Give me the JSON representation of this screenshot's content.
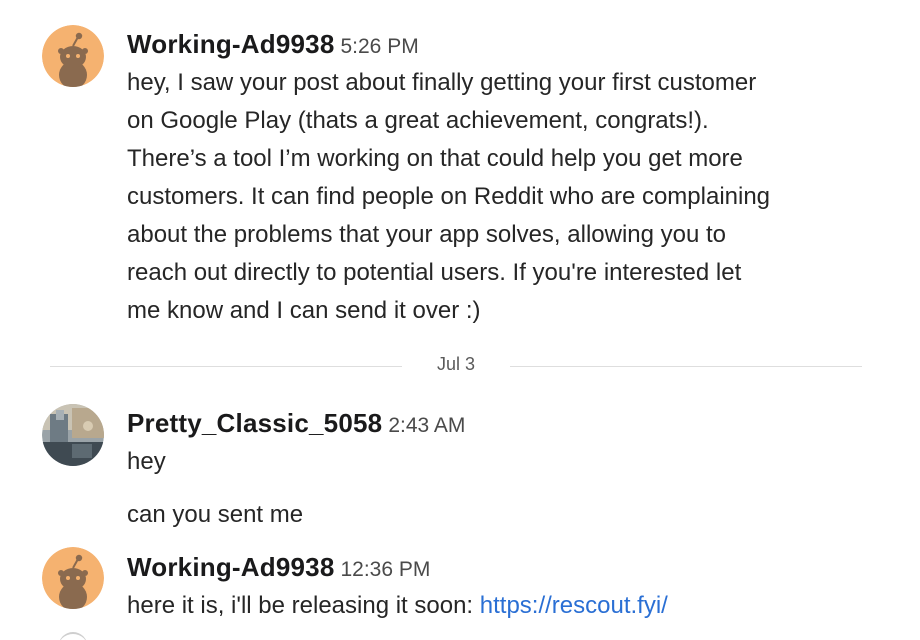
{
  "messages": [
    {
      "user": "Working-Ad9938",
      "time": "5:26 PM",
      "avatar_icon": "snoo-avatar-icon",
      "lines": [
        "hey, I saw your post about finally getting your first customer",
        "on Google Play (thats a great achievement, congrats!).",
        "There’s a tool I’m working on that could help you get more",
        "customers. It can find people on Reddit who are complaining",
        "about the problems that your app solves, allowing you to",
        "reach out directly to potential users. If you're interested let",
        "me know and I can send it over :)"
      ]
    },
    {
      "user": "Pretty_Classic_5058",
      "time": "2:43 AM",
      "avatar_icon": "photo-avatar-icon",
      "lines": [
        "hey"
      ],
      "followup": "can you sent me"
    },
    {
      "user": "Working-Ad9938",
      "time": "12:36 PM",
      "avatar_icon": "snoo-avatar-icon",
      "text_prefix": "here it is, i'll be releasing it soon: ",
      "link": "https://rescout.fyi/"
    }
  ],
  "date_divider": "Jul 3",
  "colors": {
    "link": "#2a6fd4",
    "avatar_orange": "#f5b270",
    "snoo_brown": "#8a6a4f"
  }
}
